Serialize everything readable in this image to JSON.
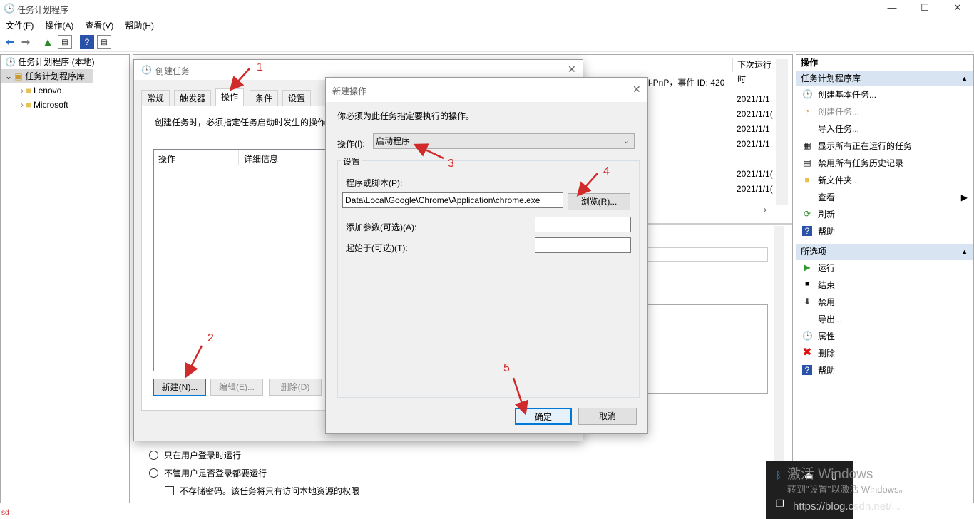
{
  "app": {
    "title": "任务计划程序",
    "win_min": "—",
    "win_max": "☐",
    "win_close": "✕"
  },
  "menu": [
    "文件(F)",
    "操作(A)",
    "查看(V)",
    "帮助(H)"
  ],
  "tree": {
    "root": "任务计划程序 (本地)",
    "library": "任务计划程序库",
    "children": [
      "Lenovo",
      "Microsoft"
    ]
  },
  "middle": {
    "next_run_header": "下次运行时",
    "event_text": "l-PnP，事件 ID: 420",
    "dates": [
      "2021/1/1",
      "2021/1/1(",
      "2021/1/1",
      "2021/1/1",
      "2021/1/1(",
      "2021/1/1("
    ]
  },
  "right": {
    "header": "操作",
    "section1": "任务计划程序库",
    "items1": [
      "创建基本任务...",
      "创建任务...",
      "导入任务...",
      "显示所有正在运行的任务",
      "禁用所有任务历史记录",
      "新文件夹...",
      "查看",
      "刷新",
      "帮助"
    ],
    "section2": "所选项",
    "items2": [
      "运行",
      "结束",
      "禁用",
      "导出...",
      "属性",
      "删除",
      "帮助"
    ]
  },
  "create_task": {
    "title": "创建任务",
    "tabs": [
      "常规",
      "触发器",
      "操作",
      "条件",
      "设置"
    ],
    "desc": "创建任务时，必须指定任务启动时发生的操作",
    "col_action": "操作",
    "col_detail": "详细信息",
    "btn_new": "新建(N)...",
    "btn_edit": "编辑(E)...",
    "btn_delete": "删除(D)",
    "radio1": "只在用户登录时运行",
    "radio2": "不管用户是否登录都要运行",
    "check1": "不存储密码。该任务将只有访问本地资源的权限"
  },
  "new_action": {
    "title": "新建操作",
    "desc": "你必须为此任务指定要执行的操作。",
    "action_label": "操作(I):",
    "action_value": "启动程序",
    "settings_label": "设置",
    "program_label": "程序或脚本(P):",
    "program_value": "Data\\Local\\Google\\Chrome\\Application\\chrome.exe",
    "browse": "浏览(R)...",
    "args_label": "添加参数(可选)(A):",
    "start_label": "起始于(可选)(T):",
    "ok": "确定",
    "cancel": "取消"
  },
  "annotations": [
    "1",
    "2",
    "3",
    "4",
    "5"
  ],
  "watermark": {
    "line1": "激活 Windows",
    "line2": "转到\"设置\"以激活 Windows。",
    "url": "https://blog.csdn.net/..."
  },
  "corner_text": "sd"
}
